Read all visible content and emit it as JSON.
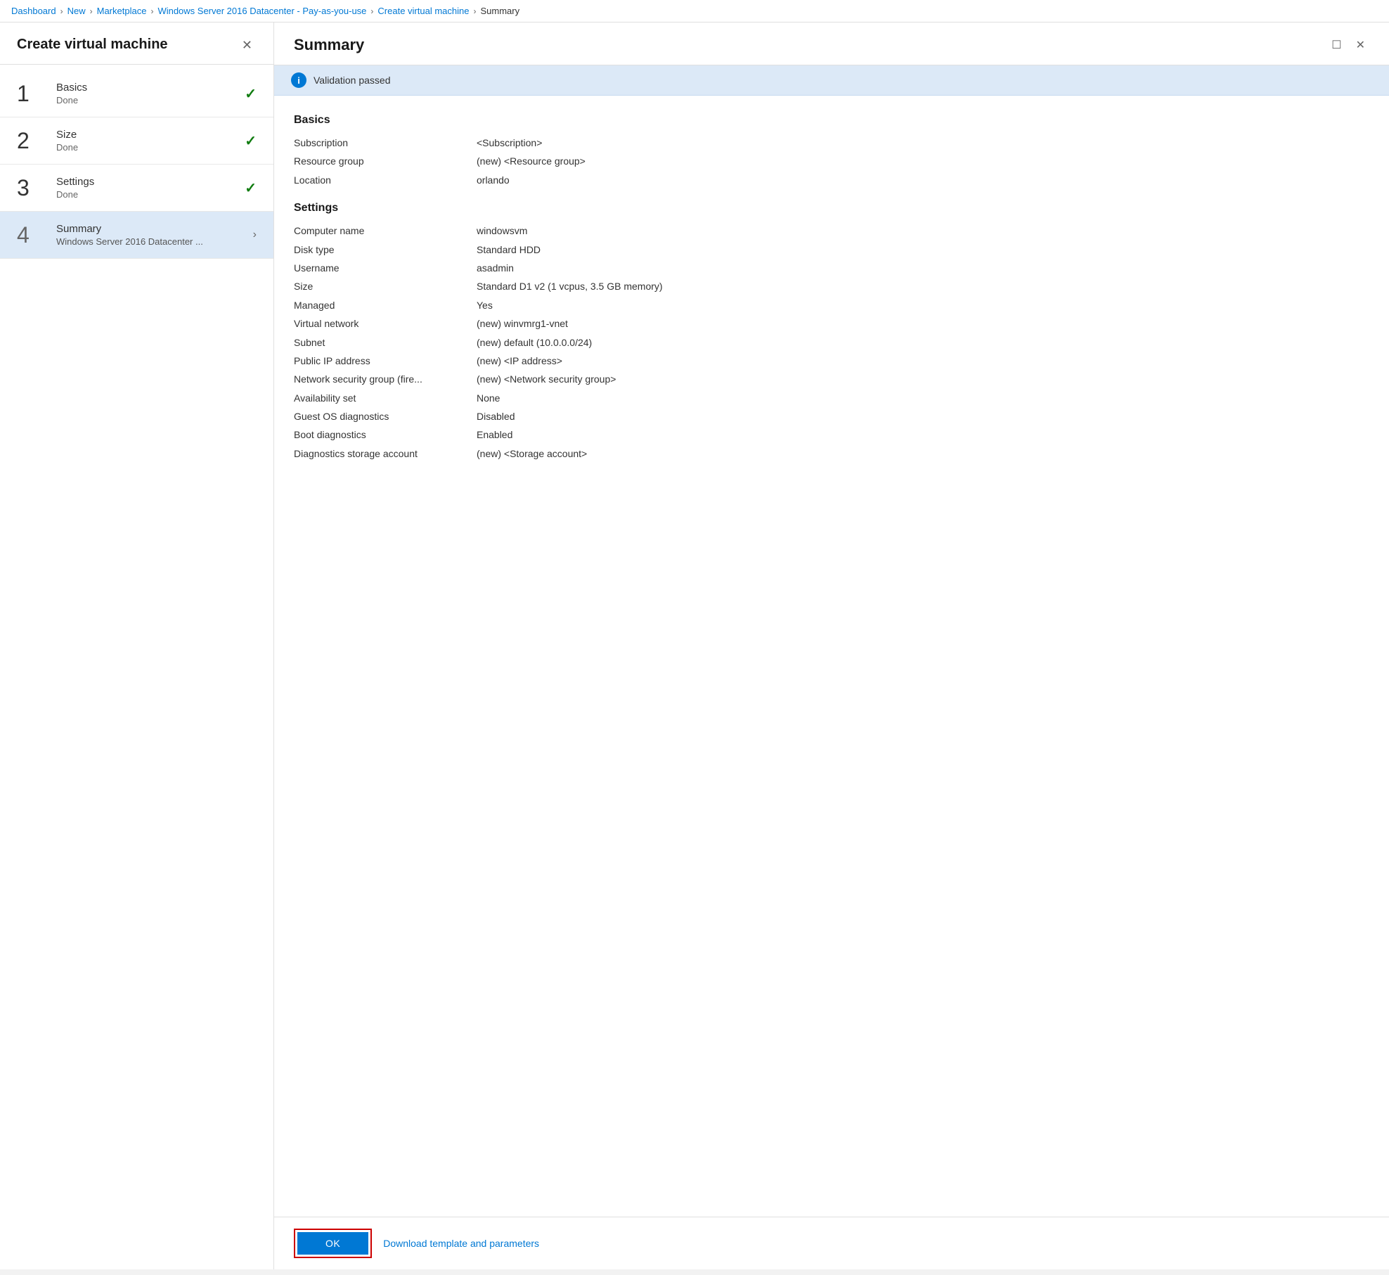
{
  "breadcrumb": {
    "items": [
      {
        "label": "Dashboard",
        "active": true
      },
      {
        "label": "New",
        "active": true
      },
      {
        "label": "Marketplace",
        "active": true
      },
      {
        "label": "Windows Server 2016 Datacenter - Pay-as-you-use",
        "active": true
      },
      {
        "label": "Create virtual machine",
        "active": true
      },
      {
        "label": "Summary",
        "active": false
      }
    ],
    "separators": [
      ">",
      ">",
      ">",
      ">",
      ">"
    ]
  },
  "left_panel": {
    "title": "Create virtual machine",
    "close_label": "✕",
    "steps": [
      {
        "number": "1",
        "name": "Basics",
        "status": "Done",
        "done": true,
        "active": false
      },
      {
        "number": "2",
        "name": "Size",
        "status": "Done",
        "done": true,
        "active": false
      },
      {
        "number": "3",
        "name": "Settings",
        "status": "Done",
        "done": true,
        "active": false
      },
      {
        "number": "4",
        "name": "Summary",
        "status": "Windows Server 2016 Datacenter ...",
        "done": false,
        "active": true,
        "hasChevron": true
      }
    ]
  },
  "right_panel": {
    "title": "Summary",
    "maximize_label": "☐",
    "close_label": "✕",
    "validation": {
      "icon": "i",
      "text": "Validation passed"
    },
    "sections": [
      {
        "title": "Basics",
        "rows": [
          {
            "label": "Subscription",
            "value": "<Subscription>"
          },
          {
            "label": "Resource group",
            "value": "(new) <Resource group>"
          },
          {
            "label": "Location",
            "value": "orlando"
          }
        ]
      },
      {
        "title": "Settings",
        "rows": [
          {
            "label": "Computer name",
            "value": "windowsvm"
          },
          {
            "label": "Disk type",
            "value": "Standard HDD"
          },
          {
            "label": "Username",
            "value": "asadmin"
          },
          {
            "label": "Size",
            "value": "Standard D1 v2 (1 vcpus, 3.5 GB memory)"
          },
          {
            "label": "Managed",
            "value": "Yes"
          },
          {
            "label": "Virtual network",
            "value": "(new) winvmrg1-vnet"
          },
          {
            "label": "Subnet",
            "value": "(new) default (10.0.0.0/24)"
          },
          {
            "label": "Public IP address",
            "value": "(new) <IP address>"
          },
          {
            "label": "Network security group (fire...",
            "value": "(new) <Network security group>"
          },
          {
            "label": "Availability set",
            "value": "None"
          },
          {
            "label": "Guest OS diagnostics",
            "value": "Disabled"
          },
          {
            "label": "Boot diagnostics",
            "value": "Enabled"
          },
          {
            "label": "Diagnostics storage account",
            "value": "(new) <Storage account>"
          }
        ]
      }
    ],
    "footer": {
      "ok_label": "OK",
      "download_link_label": "Download template and parameters"
    }
  }
}
